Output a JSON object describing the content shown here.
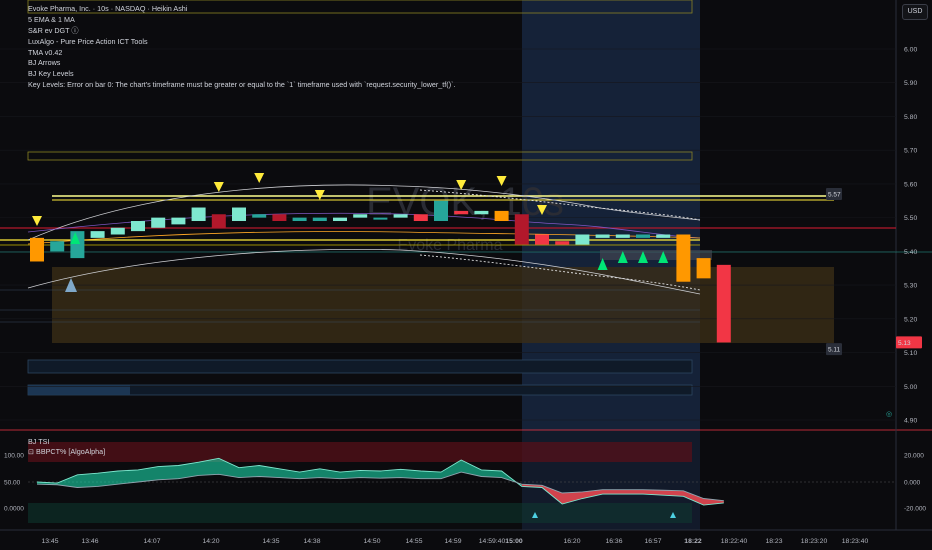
{
  "legend": {
    "title": "Evoke Pharma, Inc. · 10s · NASDAQ · Heikin Ashi",
    "indicators": [
      "5 EMA & 1 MA",
      "S&R ev DGT ⓘ",
      "LuxAlgo - Pure Price Action ICT Tools",
      "TMA v0.42",
      "BJ Arrows",
      "BJ Key Levels",
      "Key Levels: Error on bar 0: The chart's timeframe must be greater or equal to the `1` timeframe used with `request.security_lower_tf()`."
    ]
  },
  "currency": "USD",
  "watermark": {
    "symbol": "EVOK, 10s",
    "name": "Evoke Pharma"
  },
  "price_axis": [
    "6.00",
    "5.90",
    "5.80",
    "5.70",
    "5.60",
    "5.50",
    "5.40",
    "5.30",
    "5.20",
    "5.10",
    "5.00",
    "4.90"
  ],
  "price_axis_values": [
    6.0,
    5.9,
    5.8,
    5.7,
    5.6,
    5.5,
    5.4,
    5.3,
    5.2,
    5.1,
    5.0,
    4.9
  ],
  "price_tags": [
    {
      "text": "5.57",
      "value": 5.57,
      "color": "#2a2e39"
    },
    {
      "text": "5.13",
      "value": 5.13,
      "color": "#f23645"
    },
    {
      "text": "5.11",
      "value": 5.11,
      "color": "#2a2e39"
    }
  ],
  "indicator_legend": {
    "line1": "BJ TSI",
    "line2": "⊡ BBPCT% [AlgoAlpha]"
  },
  "indicator_axis": [
    "100.00",
    "50.00",
    "0.0000"
  ],
  "indicator_axis_right": [
    "20.000",
    "0.000",
    "-20.000"
  ],
  "time_axis": [
    "13:45",
    "13:46",
    "14:07",
    "14:20",
    "14:35",
    "14:38",
    "14:50",
    "14:55",
    "14:59",
    "14:59:40",
    "15:00",
    "16:20",
    "16:36",
    "16:57",
    "18:22",
    "18:22:40",
    "18:23",
    "18:23:20",
    "18:23:40"
  ],
  "colors": {
    "bull": "#7ee8cf",
    "bull_dark": "#26a69a",
    "bear": "#f23645",
    "bear_dark": "#b2182b",
    "orange": "#ff9800",
    "highlight": "#1c2b4a",
    "arrow_down": "#ffeb3b",
    "arrow_up": "#00e676"
  },
  "chart_data": {
    "type": "candlestick",
    "candles": [
      {
        "x": 1,
        "o": 5.37,
        "c": 5.44,
        "color": "orange"
      },
      {
        "x": 2,
        "o": 5.43,
        "c": 5.4,
        "color": "bull_dark"
      },
      {
        "x": 3,
        "o": 5.38,
        "c": 5.46,
        "color": "bull_dark"
      },
      {
        "x": 4,
        "o": 5.44,
        "c": 5.46,
        "color": "bull"
      },
      {
        "x": 5,
        "o": 5.45,
        "c": 5.47,
        "color": "bull"
      },
      {
        "x": 6,
        "o": 5.46,
        "c": 5.49,
        "color": "bull"
      },
      {
        "x": 7,
        "o": 5.47,
        "c": 5.5,
        "color": "bull"
      },
      {
        "x": 8,
        "o": 5.48,
        "c": 5.5,
        "color": "bull"
      },
      {
        "x": 9,
        "o": 5.49,
        "c": 5.53,
        "color": "bull"
      },
      {
        "x": 10,
        "o": 5.51,
        "c": 5.47,
        "color": "bear_dark"
      },
      {
        "x": 11,
        "o": 5.49,
        "c": 5.53,
        "color": "bull"
      },
      {
        "x": 12,
        "o": 5.51,
        "c": 5.5,
        "color": "bull_dark"
      },
      {
        "x": 13,
        "o": 5.51,
        "c": 5.49,
        "color": "bear_dark"
      },
      {
        "x": 14,
        "o": 5.49,
        "c": 5.5,
        "color": "bull_dark"
      },
      {
        "x": 15,
        "o": 5.5,
        "c": 5.49,
        "color": "bull_dark"
      },
      {
        "x": 16,
        "o": 5.49,
        "c": 5.5,
        "color": "bull"
      },
      {
        "x": 17,
        "o": 5.5,
        "c": 5.51,
        "color": "bull"
      },
      {
        "x": 18,
        "o": 5.5,
        "c": 5.5,
        "color": "bull_dark"
      },
      {
        "x": 19,
        "o": 5.5,
        "c": 5.51,
        "color": "bull"
      },
      {
        "x": 20,
        "o": 5.51,
        "c": 5.49,
        "color": "bear"
      },
      {
        "x": 21,
        "o": 5.49,
        "c": 5.55,
        "color": "bull_dark"
      },
      {
        "x": 22,
        "o": 5.52,
        "c": 5.51,
        "color": "bear"
      },
      {
        "x": 23,
        "o": 5.51,
        "c": 5.52,
        "color": "bull"
      },
      {
        "x": 24,
        "o": 5.52,
        "c": 5.49,
        "color": "orange"
      },
      {
        "x": 25,
        "o": 5.51,
        "c": 5.42,
        "color": "bear_dark"
      },
      {
        "x": 26,
        "o": 5.45,
        "c": 5.42,
        "color": "bear"
      },
      {
        "x": 27,
        "o": 5.43,
        "c": 5.42,
        "color": "bear"
      },
      {
        "x": 28,
        "o": 5.42,
        "c": 5.45,
        "color": "bull"
      },
      {
        "x": 29,
        "o": 5.44,
        "c": 5.45,
        "color": "bull"
      },
      {
        "x": 30,
        "o": 5.45,
        "c": 5.44,
        "color": "bull"
      },
      {
        "x": 31,
        "o": 5.44,
        "c": 5.45,
        "color": "bull_dark"
      },
      {
        "x": 32,
        "o": 5.45,
        "c": 5.44,
        "color": "bull"
      },
      {
        "x": 33,
        "o": 5.45,
        "c": 5.31,
        "color": "orange"
      },
      {
        "x": 34,
        "o": 5.38,
        "c": 5.32,
        "color": "orange"
      },
      {
        "x": 35,
        "o": 5.36,
        "c": 5.13,
        "color": "bear"
      }
    ],
    "down_arrows": [
      1,
      10,
      12,
      15,
      22,
      24,
      26
    ],
    "up_arrows": [
      2,
      29,
      30,
      31,
      32
    ],
    "up_arrow_grey": [
      3
    ],
    "tsi_series": [
      50,
      48,
      63,
      66,
      70,
      72,
      78,
      80,
      86,
      93,
      76,
      80,
      74,
      68,
      74,
      68,
      71,
      70,
      73,
      70,
      68,
      90,
      72,
      70,
      42,
      40,
      10,
      20,
      28,
      28,
      28,
      26,
      24,
      8,
      12
    ],
    "bbpct_series": [
      46,
      45,
      40,
      42,
      46,
      50,
      54,
      56,
      62,
      64,
      58,
      60,
      58,
      56,
      58,
      56,
      58,
      57,
      58,
      56,
      56,
      68,
      60,
      58,
      46,
      44,
      30,
      32,
      36,
      36,
      36,
      35,
      34,
      20,
      16
    ]
  }
}
